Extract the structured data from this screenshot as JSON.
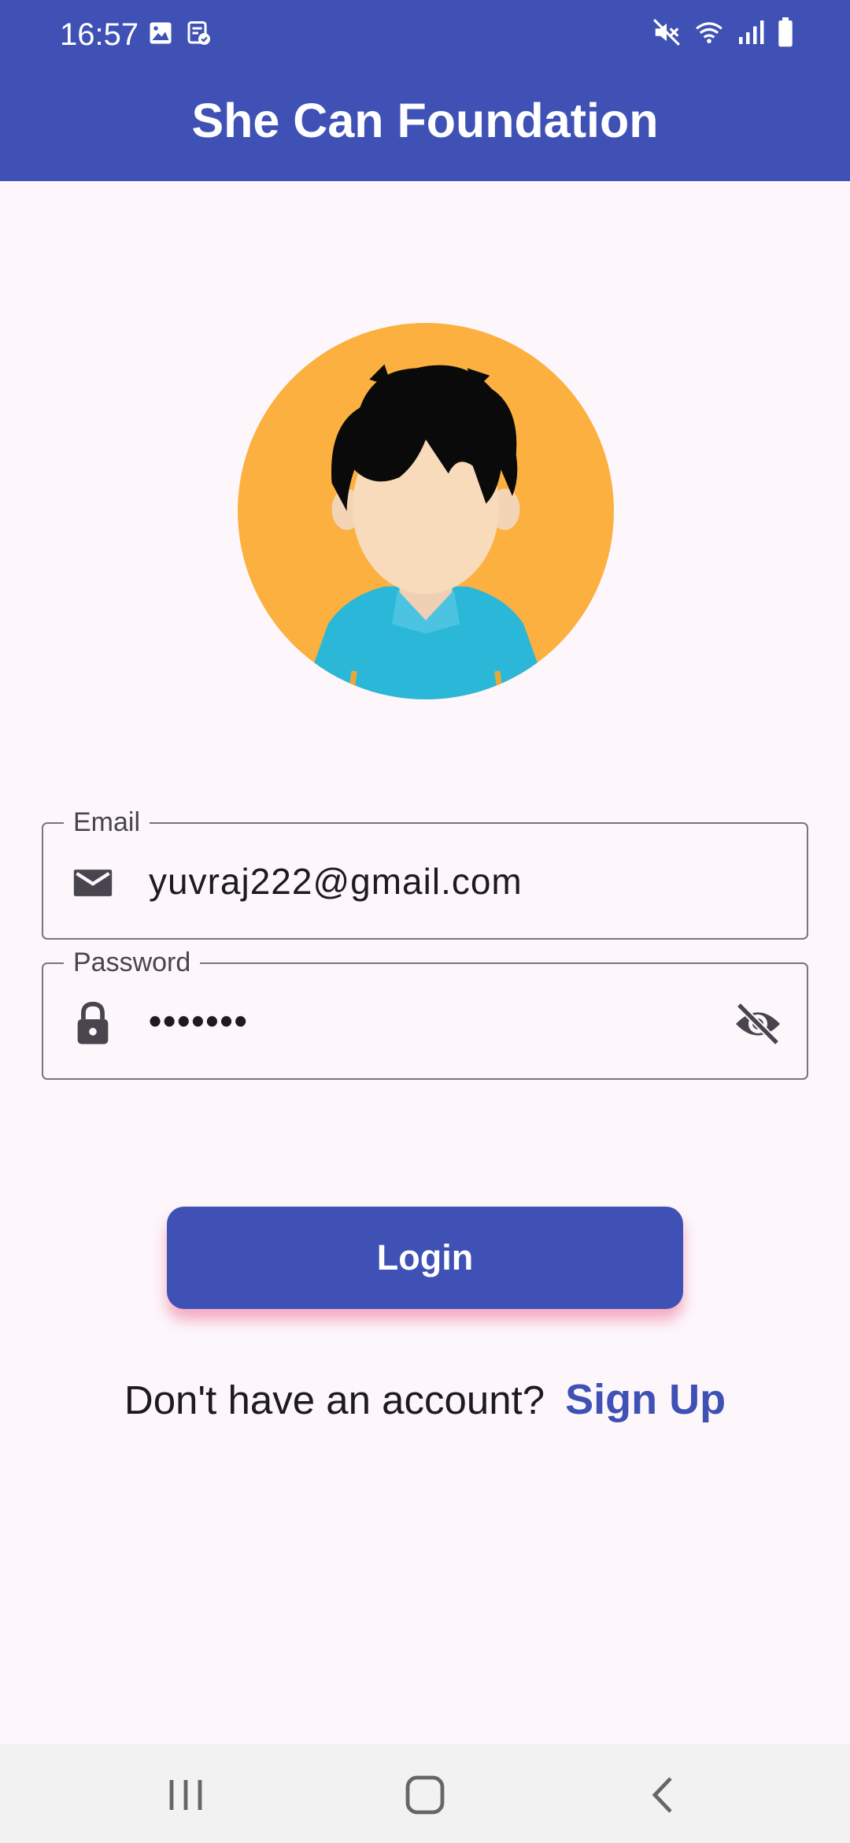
{
  "status_bar": {
    "time": "16:57",
    "left_icons": [
      "image-icon",
      "clipboard-check-icon"
    ],
    "right_icons": [
      "mute-icon",
      "wifi-icon",
      "signal-icon",
      "battery-icon"
    ]
  },
  "app_bar": {
    "title": "She Can Foundation",
    "color": "#3F51B5"
  },
  "avatar": {
    "icon": "user-avatar-illustration",
    "background": "#FCB040"
  },
  "form": {
    "email": {
      "label": "Email",
      "value": "yuvraj222@gmail.com",
      "icon": "mail-icon"
    },
    "password": {
      "label": "Password",
      "value": "•••••••",
      "icon": "lock-icon",
      "toggle_icon": "visibility-off-icon"
    }
  },
  "actions": {
    "login_label": "Login",
    "signup_prompt": "Don't have an account?",
    "signup_label": "Sign Up"
  },
  "nav_bar": {
    "buttons": [
      "recent-apps-icon",
      "home-icon",
      "back-icon"
    ]
  }
}
